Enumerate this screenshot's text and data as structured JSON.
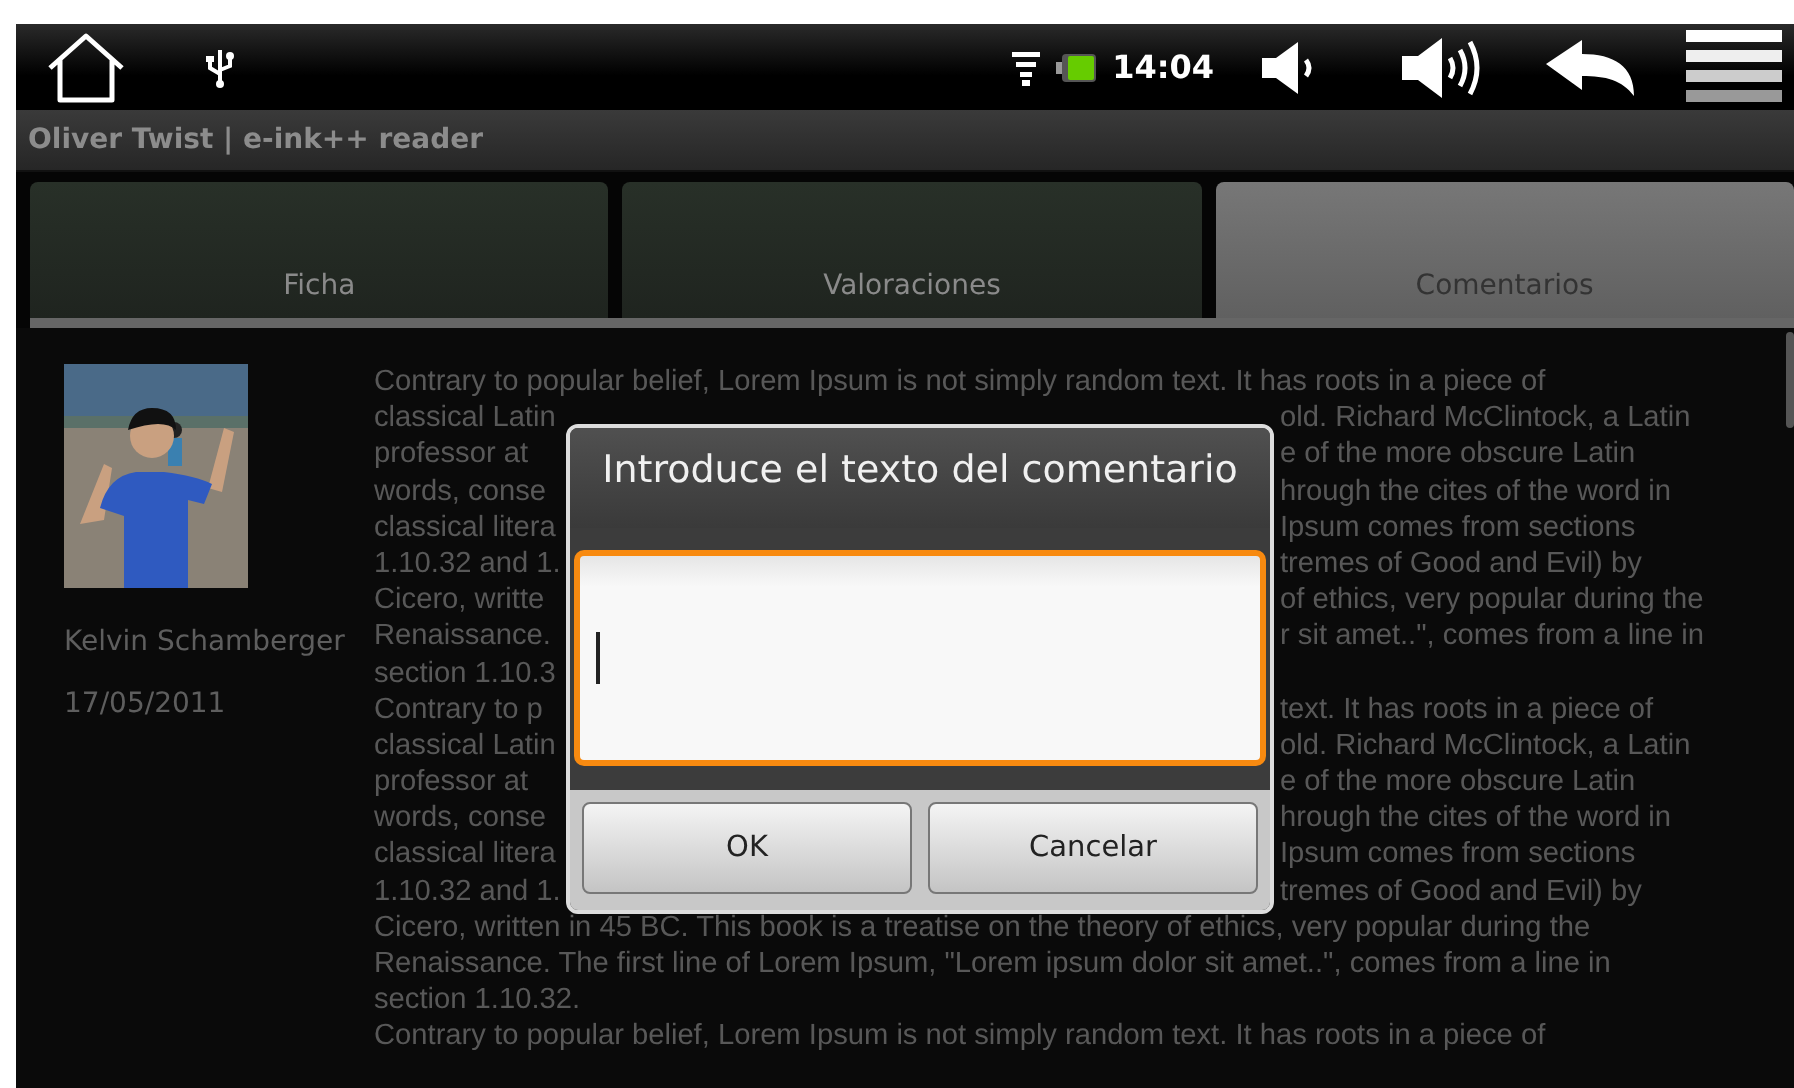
{
  "status_bar": {
    "time": "14:04"
  },
  "app_title": "Oliver Twist | e-ink++ reader",
  "tabs": [
    {
      "label": "Ficha",
      "selected": false
    },
    {
      "label": "Valoraciones",
      "selected": false
    },
    {
      "label": "Comentarios",
      "selected": true
    }
  ],
  "comment": {
    "avatar": {
      "kind": "picture"
    },
    "author": "Kelvin Schamberger",
    "date": "17/05/2011",
    "lines": [
      [
        "Contrary to popular belief, Lorem Ipsum is not simply random text. It has roots in a piece of"
      ],
      [
        "classical Latin",
        "old. Richard McClintock, a Latin"
      ],
      [
        "professor at",
        "e of the more obscure Latin"
      ],
      [
        "words, conse",
        "hrough the cites of the word in"
      ],
      [
        "classical litera",
        "Ipsum comes from sections"
      ],
      [
        "1.10.32 and 1.",
        "tremes of Good and Evil) by"
      ],
      [
        "Cicero, writte",
        "of ethics, very popular during the"
      ],
      [
        "Renaissance.",
        "r sit amet..\", comes from a line in"
      ],
      [
        "section 1.10.3"
      ],
      [
        "Contrary to p",
        "text. It has roots in a piece of"
      ],
      [
        "classical Latin",
        "old. Richard McClintock, a Latin"
      ],
      [
        "professor at",
        "e of the more obscure Latin"
      ],
      [
        "words, conse",
        "hrough the cites of the word in"
      ],
      [
        "classical litera",
        "Ipsum comes from sections"
      ],
      [
        "1.10.32 and 1.",
        "tremes of Good and Evil) by"
      ],
      [
        "Cicero, written in 45 BC. This book is a treatise on the theory of ethics, very popular during the"
      ],
      [
        "Renaissance. The first line of Lorem Ipsum, \"Lorem ipsum dolor sit amet..\", comes from a line in"
      ],
      [
        "section 1.10.32."
      ],
      [
        "Contrary to popular belief, Lorem Ipsum is not simply random text. It has roots in a piece of"
      ]
    ]
  },
  "dialog": {
    "title": "Introduce el texto del comentario",
    "input": {
      "focused": true
    },
    "buttons": [
      "OK",
      "Cancelar"
    ]
  }
}
